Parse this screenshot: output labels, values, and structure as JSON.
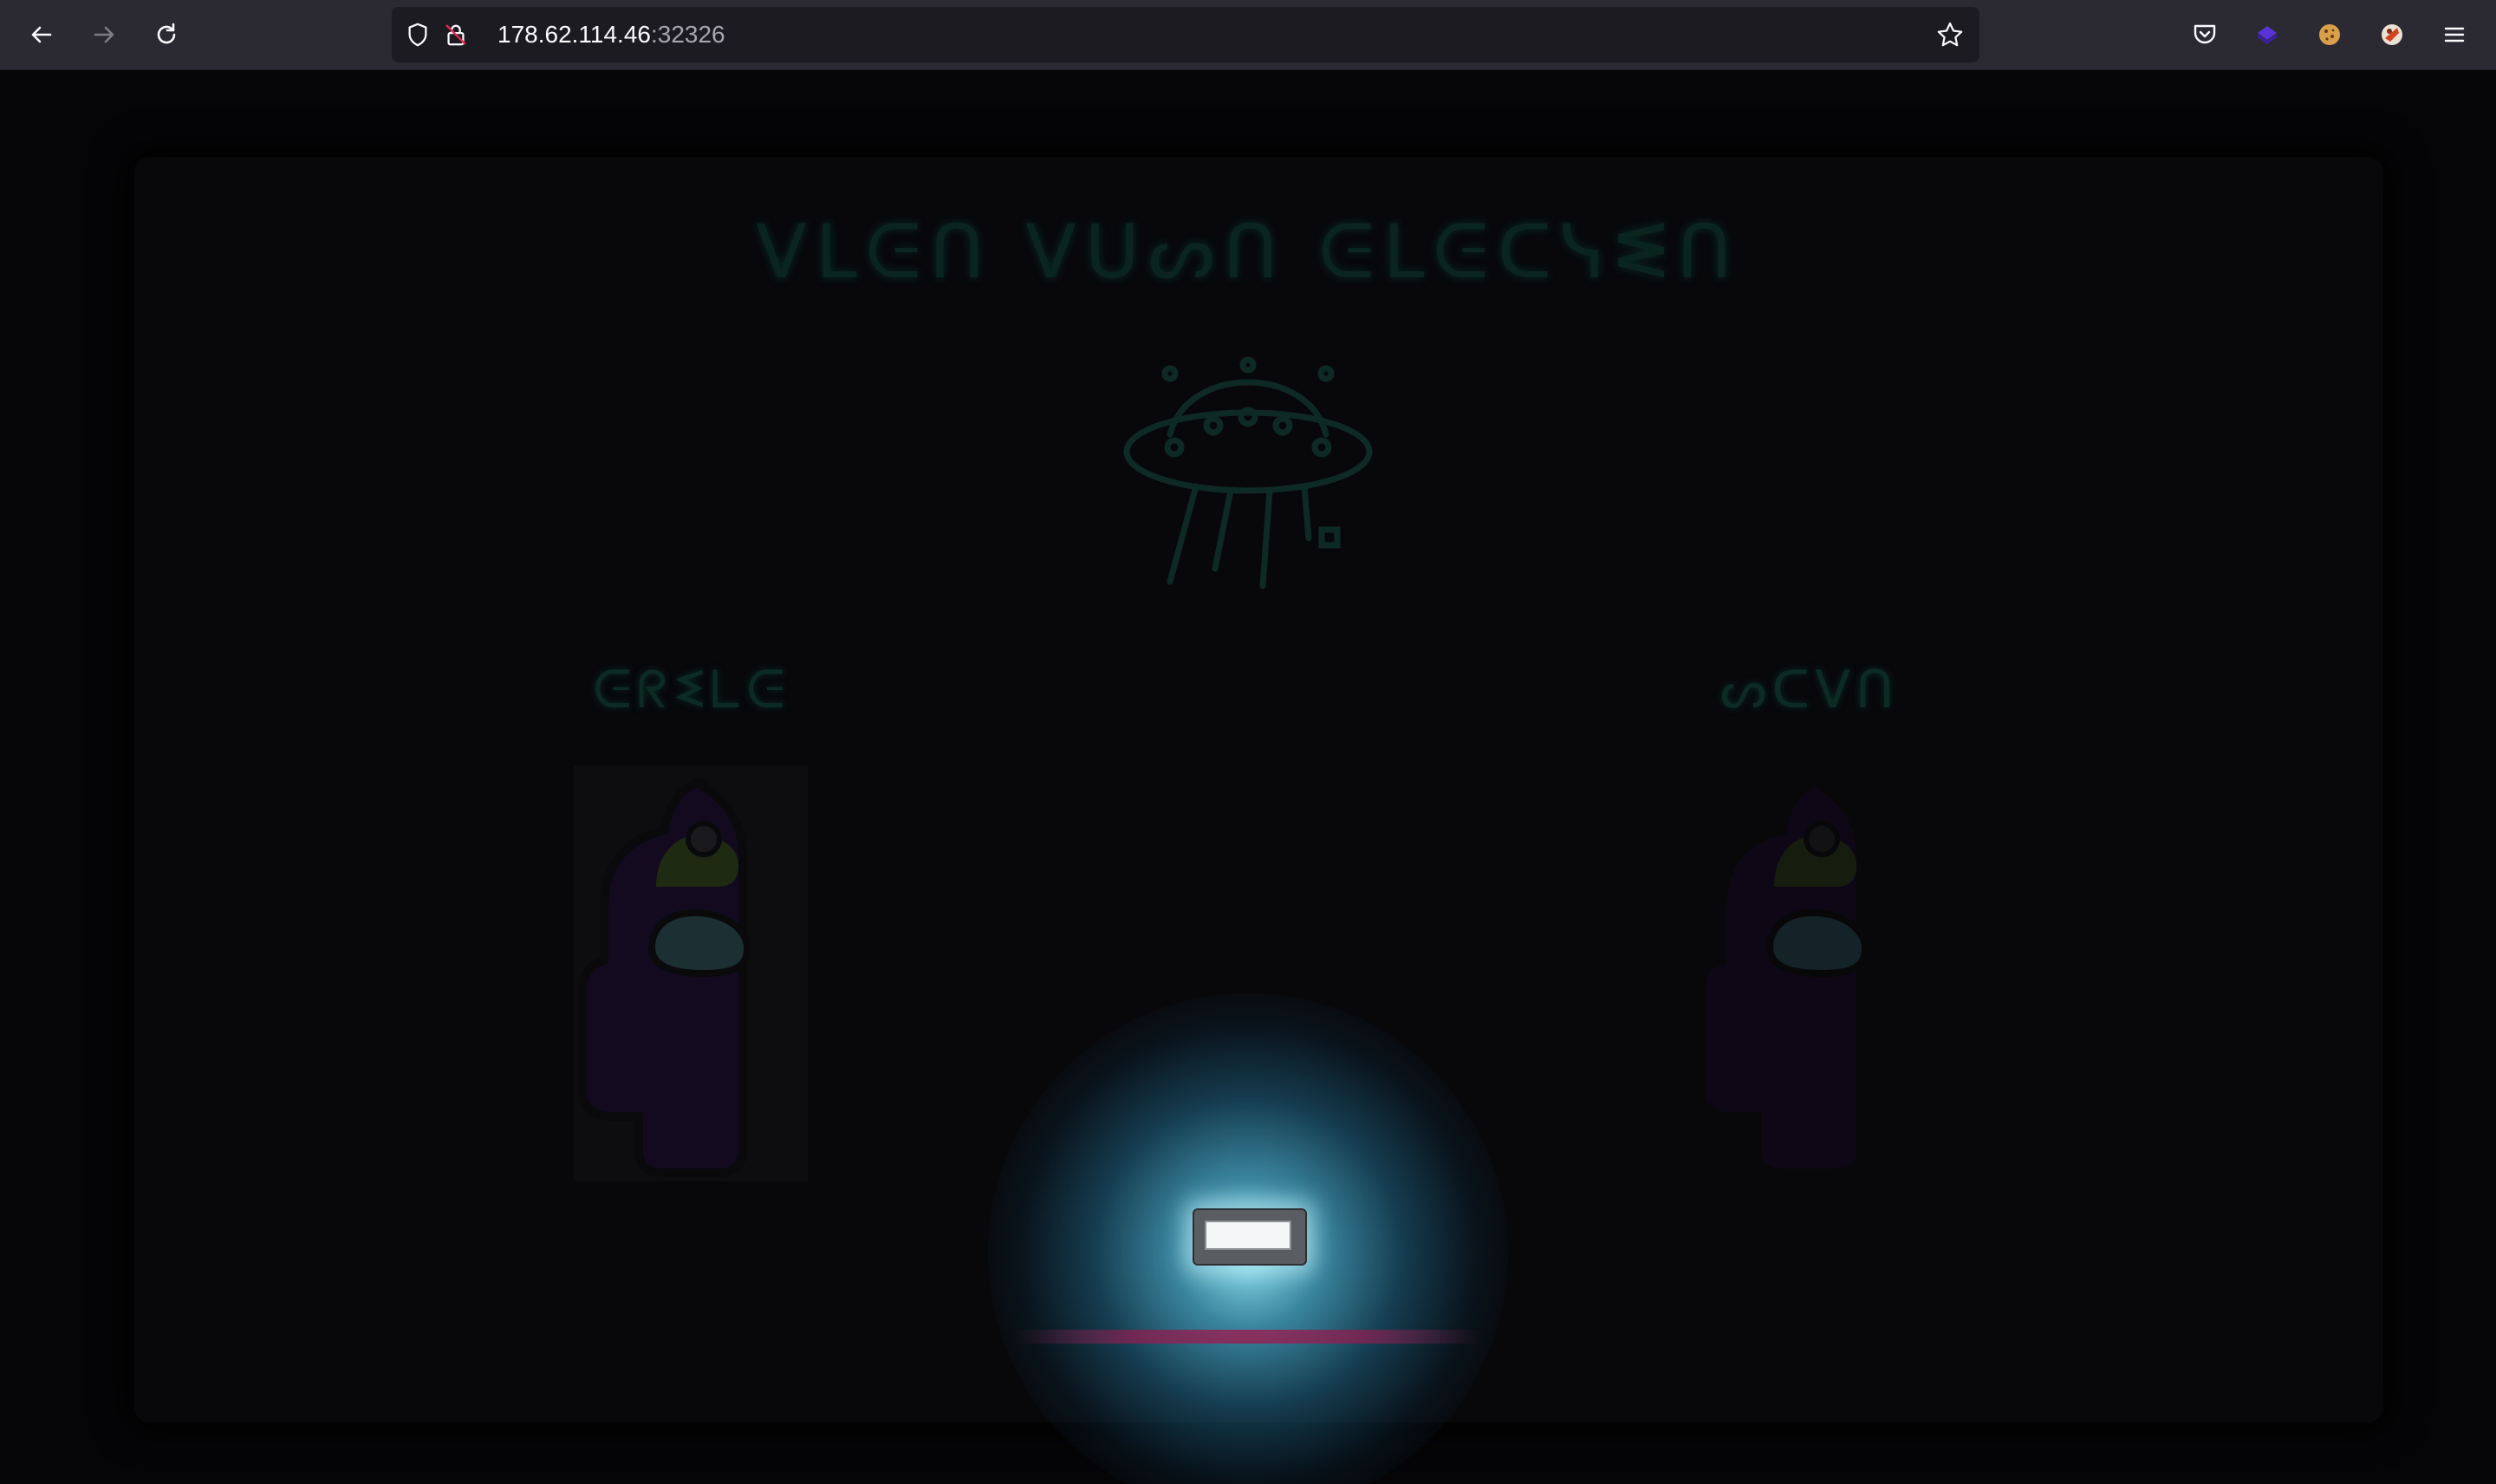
{
  "browser": {
    "url_host": "178.62.114.46",
    "url_port": ":32326",
    "icons": {
      "back": "back-arrow-icon",
      "forward": "forward-arrow-icon",
      "reload": "reload-icon",
      "tracking": "shield-icon",
      "insecure": "insecure-lock-icon",
      "bookmark": "star-icon",
      "pocket": "pocket-icon",
      "extension1": "purple-extension-icon",
      "extension2": "cookie-icon",
      "extension3": "extension-icon",
      "menu": "hamburger-menu-icon"
    }
  },
  "page": {
    "title_glyphs": "ᐯᒪᕮᑎ ᐯᑌᔕᑎ ᕮᒪᕮᑕᓭᓬᑎ",
    "left_label_glyphs": "ᕮᖇᓬᒪᕮ",
    "right_label_glyphs": "ᔕᑕᐯᑎ",
    "input_value": "",
    "colors": {
      "background": "#050507",
      "glyph_glow": "#0b2a22",
      "spotlight": "#46a5c3",
      "stage_line": "#8c1e50",
      "crewmate_body": "#1a0a2e",
      "crewmate_visor": "#2a4a52"
    }
  }
}
